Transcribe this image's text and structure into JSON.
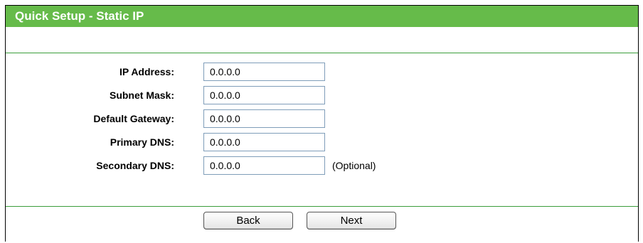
{
  "header": {
    "title": "Quick Setup - Static IP"
  },
  "form": {
    "fields": [
      {
        "label": "IP Address:",
        "value": "0.0.0.0"
      },
      {
        "label": "Subnet Mask:",
        "value": "0.0.0.0"
      },
      {
        "label": "Default Gateway:",
        "value": "0.0.0.0"
      },
      {
        "label": "Primary DNS:",
        "value": "0.0.0.0"
      },
      {
        "label": "Secondary DNS:",
        "value": "0.0.0.0",
        "hint": "(Optional)"
      }
    ]
  },
  "buttons": {
    "back_label": "Back",
    "next_label": "Next"
  },
  "colors": {
    "header_bg": "#66bb4a",
    "divider": "#3a9d3a"
  }
}
